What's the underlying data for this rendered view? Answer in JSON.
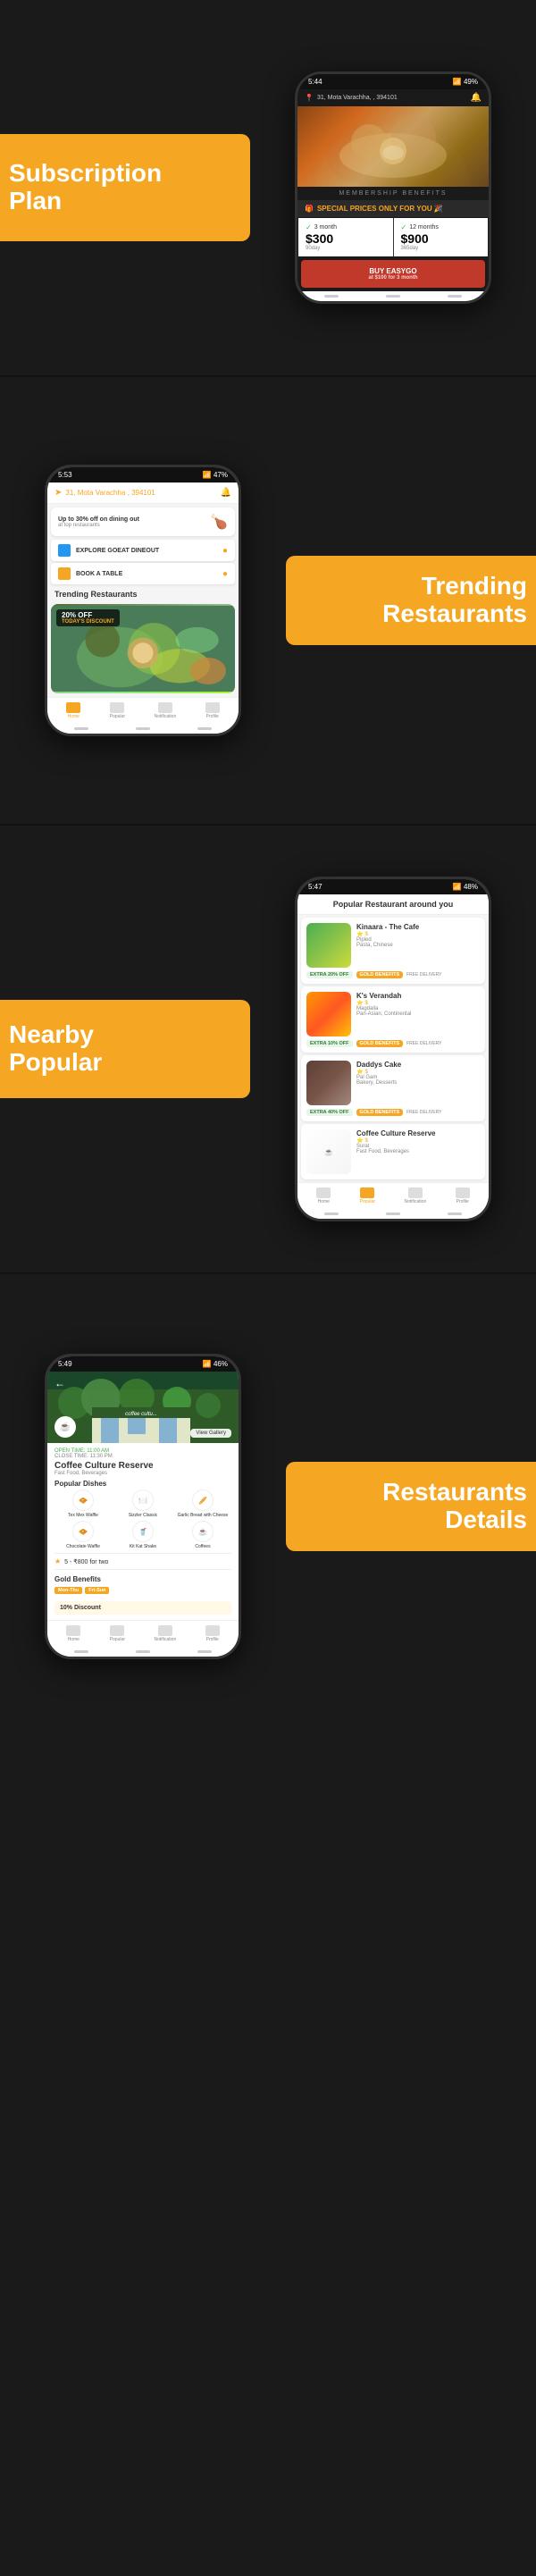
{
  "sections": {
    "subscription": {
      "label_line1": "Subscription",
      "label_line2": "Plan",
      "phone": {
        "status_bar": "5:44",
        "location": "31, Mota Varachha, , 394101",
        "membership_bar": "MEMBERSHIP BENEFITS",
        "special_prices": "SPECIAL PRICES ONLY FOR YOU 🎉",
        "pricing": [
          {
            "period": "3 month",
            "amount": "$300",
            "days": "90day"
          },
          {
            "period": "12 months",
            "amount": "$900",
            "days": "365day"
          }
        ],
        "buy_label": "BUY EASYGO",
        "buy_sub": "at $100 for 3 month"
      }
    },
    "trending": {
      "label_line1": "Trending",
      "label_line2": "Restaurants",
      "phone": {
        "status_bar": "5:53",
        "location": "31, Mota Varachha , 394101",
        "promo_title": "Up to 30% off on dining out",
        "promo_sub": "at top restaurants",
        "explore_btn": "EXPLORE GOEAT DINEOUT",
        "book_btn": "BOOK A TABLE",
        "trending_title": "Trending Restaurants",
        "discount_badge": "20% OFF",
        "discount_sub": "TODAY'S DISCOUNT"
      }
    },
    "nearby": {
      "label_line1": "Nearby",
      "label_line2": "Popular",
      "phone": {
        "status_bar": "5:47",
        "title": "Popular Restaurant around you",
        "restaurants": [
          {
            "name": "Kinaara - The Cafe",
            "rating": "$",
            "location": "Pipled",
            "cuisine": "Pasta, Chinese",
            "badge": "EXTRA 20% OFF",
            "badge_type": "GOLD BENEFITS",
            "color_type": "salad"
          },
          {
            "name": "K's Verandah",
            "rating": "$",
            "location": "Magdalla",
            "cuisine": "Pan-Asian, Continental",
            "badge": "EXTRA 10% OFF",
            "badge_type": "GOLD BENEFITS",
            "color_type": "noodles"
          },
          {
            "name": "Daddys Cake",
            "rating": "$",
            "location": "Pal Gam",
            "cuisine": "Bakery, Desserts",
            "badge": "EXTRA 40% OFF",
            "badge_type": "GOLD BENEFITS",
            "color_type": "cake"
          },
          {
            "name": "Coffee Culture Reserve",
            "rating": "$",
            "location": "Surat",
            "cuisine": "Fast Food, Beverages",
            "badge": "",
            "badge_type": "",
            "color_type": "coffee"
          }
        ]
      }
    },
    "details": {
      "label_line1": "Restaurants",
      "label_line2": "Details",
      "phone": {
        "status_bar": "5:49",
        "restaurant_name": "Coffee Culture Reserve",
        "restaurant_type": "Fast Food, Beverages",
        "open_time": "OPEN TIME: 11:00 AM",
        "close_time": "CLOSE TIME: 11:30 PM",
        "gallery_btn": "View Gallery",
        "popular_dishes_title": "Popular Dishes",
        "dishes": [
          {
            "label": "Tex Mex Waffle",
            "icon": "🧇"
          },
          {
            "label": "Sizzler Classic",
            "icon": "🍽️"
          },
          {
            "label": "Garlic Bread with Cheese",
            "icon": "🥖"
          },
          {
            "label": "Chocolate Waffle",
            "icon": "🧇"
          },
          {
            "label": "Kit Kat Shake",
            "icon": "🥤"
          },
          {
            "label": "Coffees",
            "icon": "☕"
          }
        ],
        "rating": "5",
        "price": "800 for two",
        "gold_benefits_title": "Gold Benefits",
        "days_on": [
          "Mon-Thu",
          "Fri-Sun"
        ],
        "discount_title": "10% Discount"
      }
    }
  }
}
